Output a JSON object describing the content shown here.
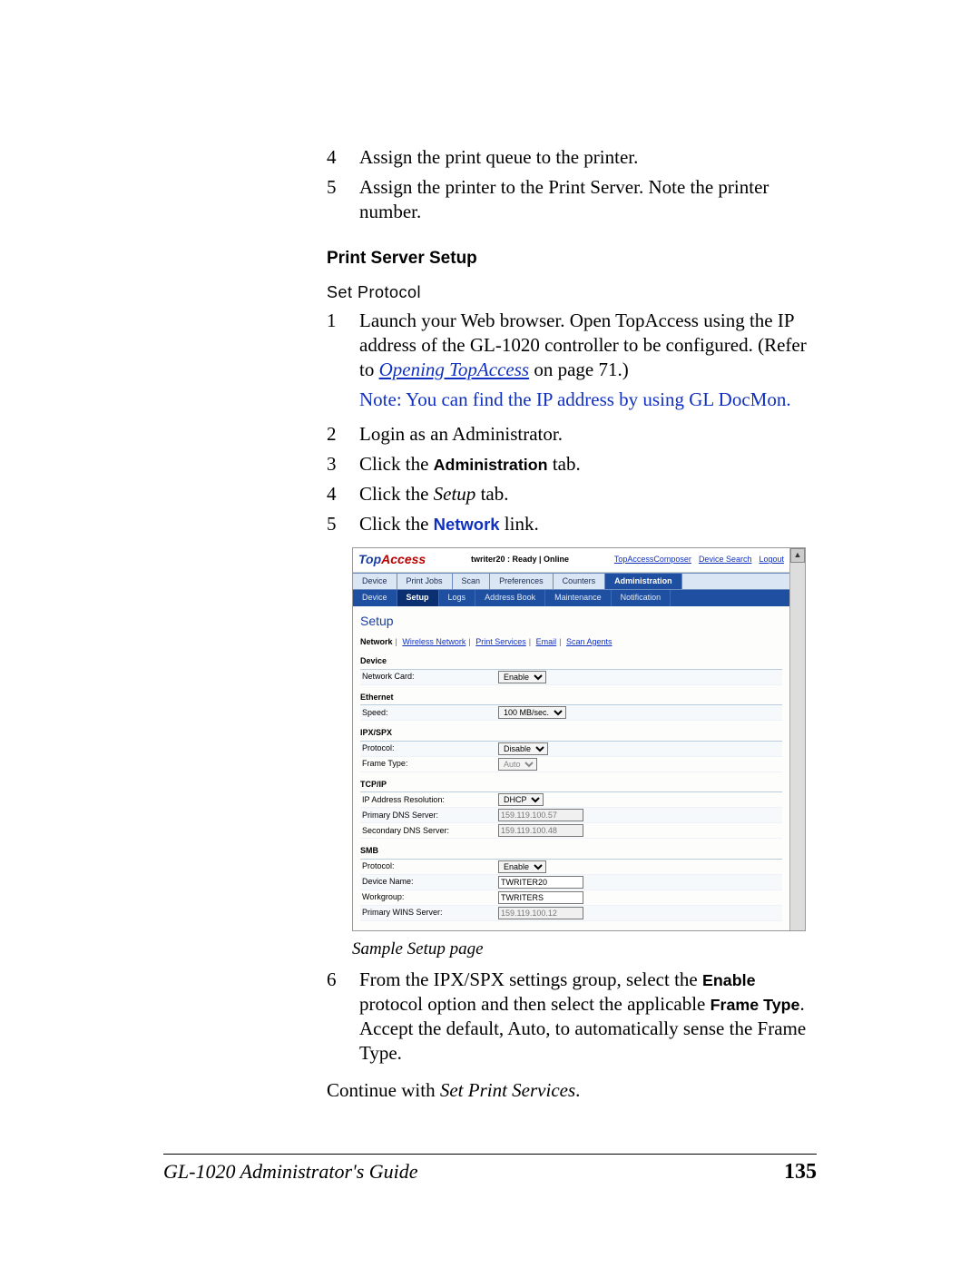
{
  "steps_top": [
    {
      "n": "4",
      "text": "Assign the print queue to the printer."
    },
    {
      "n": "5",
      "text": "Assign the printer to the Print Server. Note the printer number."
    }
  ],
  "heading": "Print Server Setup",
  "subheading": "Set Protocol",
  "step1": {
    "n": "1",
    "pre": "Launch your Web browser. Open TopAccess using the IP address of the GL-1020 controller to be configured. (Refer to ",
    "link": "Opening TopAccess",
    "post": " on page 71.)"
  },
  "note": "Note: You can find the IP address by using GL DocMon.",
  "step2": {
    "n": "2",
    "text": "Login as an Administrator."
  },
  "step3": {
    "n": "3",
    "pre": "Click the ",
    "bold": "Administration",
    "post": " tab."
  },
  "step4": {
    "n": "4",
    "pre": "Click the ",
    "italic": "Setup",
    "post": " tab."
  },
  "step5": {
    "n": "5",
    "pre": "Click the ",
    "bold": "Network",
    "post": " link."
  },
  "ta": {
    "logo_top": "Top",
    "logo_access": "Access",
    "status": "twriter20 : Ready | Online",
    "composer": "TopAccessComposer",
    "devsearch": "Device Search",
    "logout": "Logout",
    "tabs1": [
      "Device",
      "Print Jobs",
      "Scan",
      "Preferences",
      "Counters",
      "Administration"
    ],
    "tabs2": [
      "Device",
      "Setup",
      "Logs",
      "Address Book",
      "Maintenance",
      "Notification"
    ],
    "panel_title": "Setup",
    "sublinks": [
      "Network",
      "Wireless Network",
      "Print Services",
      "Email",
      "Scan Agents"
    ],
    "sections": {
      "device": {
        "h": "Device",
        "rows": [
          {
            "label": "Network Card:",
            "type": "select",
            "value": "Enable"
          }
        ]
      },
      "ethernet": {
        "h": "Ethernet",
        "rows": [
          {
            "label": "Speed:",
            "type": "select",
            "value": "100 MB/sec."
          }
        ]
      },
      "ipx": {
        "h": "IPX/SPX",
        "rows": [
          {
            "label": "Protocol:",
            "type": "select",
            "value": "Disable"
          },
          {
            "label": "Frame Type:",
            "type": "select",
            "value": "Auto",
            "gray": true
          }
        ]
      },
      "tcpip": {
        "h": "TCP/IP",
        "rows": [
          {
            "label": "IP Address Resolution:",
            "type": "select",
            "value": "DHCP"
          },
          {
            "label": "Primary DNS Server:",
            "type": "input",
            "value": "159.119.100.57",
            "gray": true
          },
          {
            "label": "Secondary DNS Server:",
            "type": "input",
            "value": "159.119.100.48",
            "gray": true
          }
        ]
      },
      "smb": {
        "h": "SMB",
        "rows": [
          {
            "label": "Protocol:",
            "type": "select",
            "value": "Enable"
          },
          {
            "label": "Device Name:",
            "type": "input",
            "value": "TWRITER20"
          },
          {
            "label": "Workgroup:",
            "type": "input",
            "value": "TWRITERS"
          },
          {
            "label": "Primary WINS Server:",
            "type": "input",
            "value": "159.119.100.12",
            "gray": true
          }
        ]
      }
    }
  },
  "caption": "Sample Setup page",
  "step6": {
    "n": "6",
    "p1": "From the IPX/SPX settings group, select the ",
    "b1": "Enable",
    "p2": " protocol option and then select the applicable ",
    "b2": "Frame Type",
    "p3": ". Accept the default, Auto, to automatically sense the Frame Type."
  },
  "continue_pre": "Continue with ",
  "continue_italic": "Set Print Services",
  "continue_post": ".",
  "footer_left": "GL-1020 Administrator's Guide",
  "footer_page": "135"
}
